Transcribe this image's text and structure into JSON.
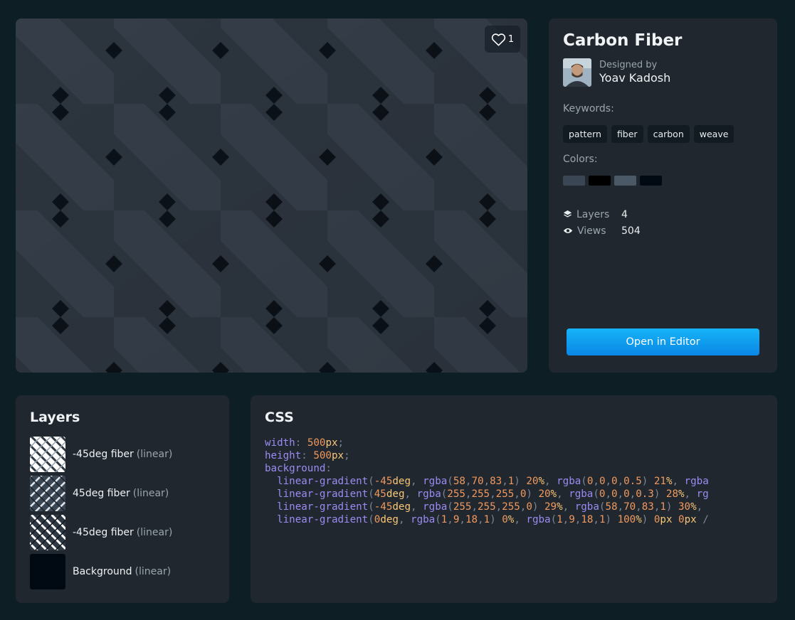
{
  "preview": {
    "like_count": "1",
    "colors": {
      "band": "#3a4653",
      "base": "#2c343e",
      "gap": "#0b1118",
      "shadow": "#000000"
    }
  },
  "info": {
    "title": "Carbon Fiber",
    "designed_by_label": "Designed by",
    "author_name": "Yoav Kadosh",
    "keywords_label": "Keywords:",
    "keywords": [
      "pattern",
      "fiber",
      "carbon",
      "weave"
    ],
    "colors_label": "Colors:",
    "colors": [
      "#3a4653",
      "#000000",
      "#4b5866",
      "#010912"
    ],
    "stats": {
      "layers_label": "Layers",
      "layers_value": "4",
      "views_label": "Views",
      "views_value": "504"
    },
    "open_button_label": "Open in Editor"
  },
  "layers": {
    "title": "Layers",
    "items": [
      {
        "name": "-45deg fiber",
        "type": "(linear)",
        "thumb": "light-neg"
      },
      {
        "name": "45deg fiber",
        "type": "(linear)",
        "thumb": "dark-pos"
      },
      {
        "name": "-45deg fiber",
        "type": "(linear)",
        "thumb": "dark-neg"
      },
      {
        "name": "Background",
        "type": "(linear)",
        "thumb": "solid"
      }
    ]
  },
  "css": {
    "title": "CSS",
    "lines": [
      [
        [
          "prop",
          "width"
        ],
        [
          "p",
          ": "
        ],
        [
          "num",
          "500"
        ],
        [
          "unit",
          "px"
        ],
        [
          "p",
          ";"
        ]
      ],
      [
        [
          "prop",
          "height"
        ],
        [
          "p",
          ": "
        ],
        [
          "num",
          "500"
        ],
        [
          "unit",
          "px"
        ],
        [
          "p",
          ";"
        ]
      ],
      [
        [
          "prop",
          "background"
        ],
        [
          "p",
          ":"
        ]
      ],
      [
        [
          "p",
          "  "
        ],
        [
          "fn",
          "linear-gradient"
        ],
        [
          "p",
          "("
        ],
        [
          "num",
          "-45"
        ],
        [
          "unit",
          "deg"
        ],
        [
          "p",
          ", "
        ],
        [
          "fn",
          "rgba"
        ],
        [
          "p",
          "("
        ],
        [
          "num",
          "58"
        ],
        [
          "p",
          ","
        ],
        [
          "num",
          "70"
        ],
        [
          "p",
          ","
        ],
        [
          "num",
          "83"
        ],
        [
          "p",
          ","
        ],
        [
          "num",
          "1"
        ],
        [
          "p",
          ") "
        ],
        [
          "num",
          "20"
        ],
        [
          "unit",
          "%"
        ],
        [
          "p",
          ", "
        ],
        [
          "fn",
          "rgba"
        ],
        [
          "p",
          "("
        ],
        [
          "num",
          "0"
        ],
        [
          "p",
          ","
        ],
        [
          "num",
          "0"
        ],
        [
          "p",
          ","
        ],
        [
          "num",
          "0"
        ],
        [
          "p",
          ","
        ],
        [
          "num",
          "0.5"
        ],
        [
          "p",
          ") "
        ],
        [
          "num",
          "21"
        ],
        [
          "unit",
          "%"
        ],
        [
          "p",
          ", "
        ],
        [
          "fn",
          "rgba"
        ]
      ],
      [
        [
          "p",
          "  "
        ],
        [
          "fn",
          "linear-gradient"
        ],
        [
          "p",
          "("
        ],
        [
          "num",
          "45"
        ],
        [
          "unit",
          "deg"
        ],
        [
          "p",
          ", "
        ],
        [
          "fn",
          "rgba"
        ],
        [
          "p",
          "("
        ],
        [
          "num",
          "255"
        ],
        [
          "p",
          ","
        ],
        [
          "num",
          "255"
        ],
        [
          "p",
          ","
        ],
        [
          "num",
          "255"
        ],
        [
          "p",
          ","
        ],
        [
          "num",
          "0"
        ],
        [
          "p",
          ") "
        ],
        [
          "num",
          "20"
        ],
        [
          "unit",
          "%"
        ],
        [
          "p",
          ", "
        ],
        [
          "fn",
          "rgba"
        ],
        [
          "p",
          "("
        ],
        [
          "num",
          "0"
        ],
        [
          "p",
          ","
        ],
        [
          "num",
          "0"
        ],
        [
          "p",
          ","
        ],
        [
          "num",
          "0"
        ],
        [
          "p",
          ","
        ],
        [
          "num",
          "0.3"
        ],
        [
          "p",
          ") "
        ],
        [
          "num",
          "28"
        ],
        [
          "unit",
          "%"
        ],
        [
          "p",
          ", "
        ],
        [
          "fn",
          "rg"
        ]
      ],
      [
        [
          "p",
          "  "
        ],
        [
          "fn",
          "linear-gradient"
        ],
        [
          "p",
          "("
        ],
        [
          "num",
          "-45"
        ],
        [
          "unit",
          "deg"
        ],
        [
          "p",
          ", "
        ],
        [
          "fn",
          "rgba"
        ],
        [
          "p",
          "("
        ],
        [
          "num",
          "255"
        ],
        [
          "p",
          ","
        ],
        [
          "num",
          "255"
        ],
        [
          "p",
          ","
        ],
        [
          "num",
          "255"
        ],
        [
          "p",
          ","
        ],
        [
          "num",
          "0"
        ],
        [
          "p",
          ") "
        ],
        [
          "num",
          "29"
        ],
        [
          "unit",
          "%"
        ],
        [
          "p",
          ", "
        ],
        [
          "fn",
          "rgba"
        ],
        [
          "p",
          "("
        ],
        [
          "num",
          "58"
        ],
        [
          "p",
          ","
        ],
        [
          "num",
          "70"
        ],
        [
          "p",
          ","
        ],
        [
          "num",
          "83"
        ],
        [
          "p",
          ","
        ],
        [
          "num",
          "1"
        ],
        [
          "p",
          ") "
        ],
        [
          "num",
          "30"
        ],
        [
          "unit",
          "%"
        ],
        [
          "p",
          ","
        ]
      ],
      [
        [
          "p",
          "  "
        ],
        [
          "fn",
          "linear-gradient"
        ],
        [
          "p",
          "("
        ],
        [
          "num",
          "0"
        ],
        [
          "unit",
          "deg"
        ],
        [
          "p",
          ", "
        ],
        [
          "fn",
          "rgba"
        ],
        [
          "p",
          "("
        ],
        [
          "num",
          "1"
        ],
        [
          "p",
          ","
        ],
        [
          "num",
          "9"
        ],
        [
          "p",
          ","
        ],
        [
          "num",
          "18"
        ],
        [
          "p",
          ","
        ],
        [
          "num",
          "1"
        ],
        [
          "p",
          ") "
        ],
        [
          "num",
          "0"
        ],
        [
          "unit",
          "%"
        ],
        [
          "p",
          ", "
        ],
        [
          "fn",
          "rgba"
        ],
        [
          "p",
          "("
        ],
        [
          "num",
          "1"
        ],
        [
          "p",
          ","
        ],
        [
          "num",
          "9"
        ],
        [
          "p",
          ","
        ],
        [
          "num",
          "18"
        ],
        [
          "p",
          ","
        ],
        [
          "num",
          "1"
        ],
        [
          "p",
          ") "
        ],
        [
          "num",
          "100"
        ],
        [
          "unit",
          "%"
        ],
        [
          "p",
          ") "
        ],
        [
          "num",
          "0"
        ],
        [
          "unit",
          "px"
        ],
        [
          "p",
          " "
        ],
        [
          "num",
          "0"
        ],
        [
          "unit",
          "px"
        ],
        [
          "p",
          " /"
        ]
      ]
    ]
  }
}
